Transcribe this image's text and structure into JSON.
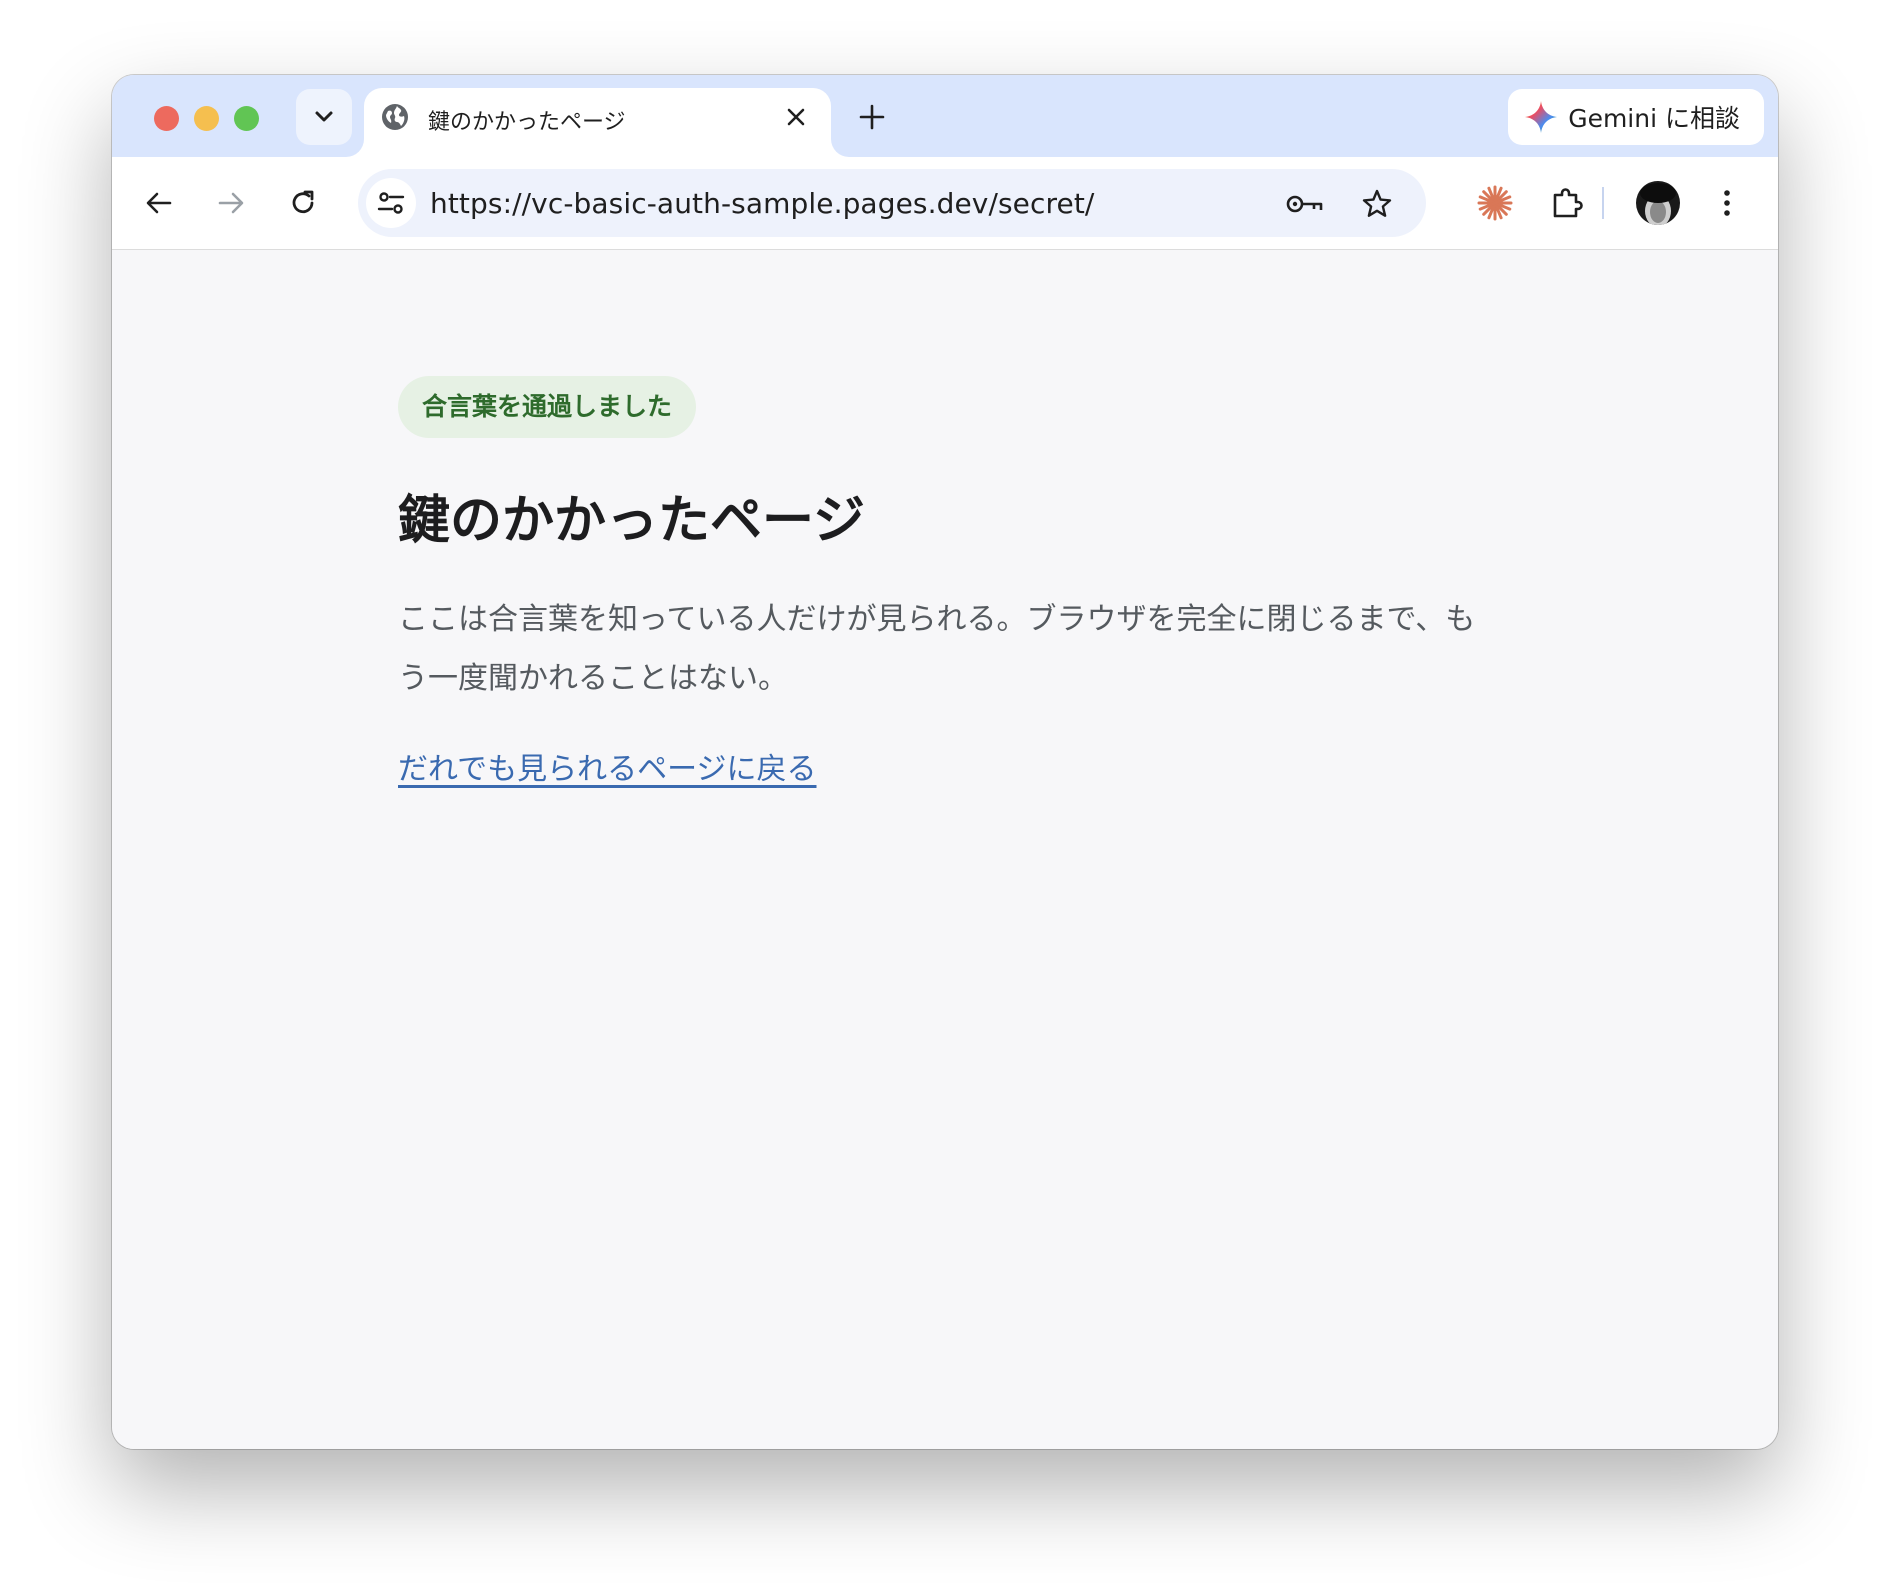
{
  "tab": {
    "title": "鍵のかかったページ"
  },
  "gemini": {
    "label": "Gemini に相談"
  },
  "omnibox": {
    "url": "https://vc-basic-auth-sample.pages.dev/secret/"
  },
  "page": {
    "badge": "合言葉を通過しました",
    "heading": "鍵のかかったページ",
    "body": "ここは合言葉を知っている人だけが見られる。ブラウザを完全に閉じるまで、もう一度聞かれることはない。",
    "link": "だれでも見られるページに戻る"
  },
  "icons": {
    "tab_search": "chevron-down-icon",
    "favicon": "globe-icon",
    "tab_close": "close-icon",
    "new_tab": "plus-icon",
    "gemini": "sparkle-icon",
    "back": "arrow-left-icon",
    "forward": "arrow-right-icon",
    "reload": "reload-icon",
    "site_info": "tune-icon",
    "password": "key-icon",
    "bookmark": "star-icon",
    "extension_claude": "asterisk-icon",
    "extensions": "puzzle-icon",
    "profile": "avatar",
    "menu": "kebab-menu-icon"
  },
  "colors": {
    "tab_strip": "#d9e5fd",
    "badge_bg": "#e6f1e4",
    "badge_text": "#2e6b2c",
    "link": "#3a6ab0",
    "page_bg": "#f7f7f9",
    "claude_orange": "#d97757"
  }
}
